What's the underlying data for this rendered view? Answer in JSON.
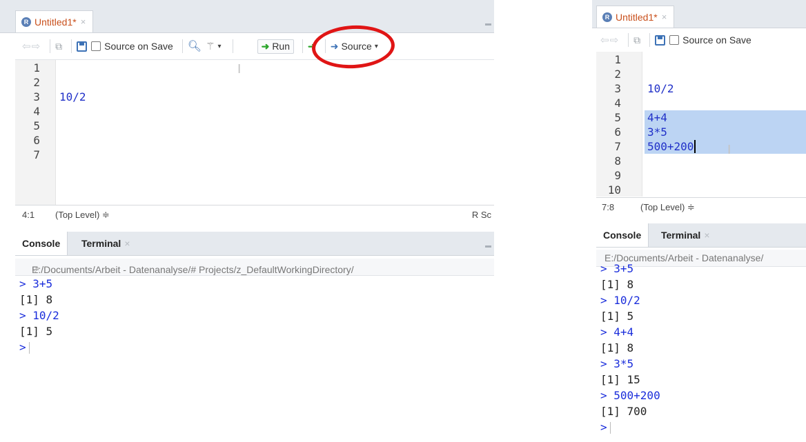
{
  "left": {
    "tab": {
      "title": "Untitled1*",
      "close": "×"
    },
    "toolbar": {
      "source_on_save": "Source on Save",
      "run": "Run",
      "source": "Source"
    },
    "editor": {
      "lines": [
        {
          "num": "1",
          "code": ""
        },
        {
          "num": "2",
          "code": ""
        },
        {
          "num": "3",
          "code": "10/2"
        },
        {
          "num": "4",
          "code": ""
        },
        {
          "num": "5",
          "code": ""
        },
        {
          "num": "6",
          "code": ""
        },
        {
          "num": "7",
          "code": ""
        }
      ]
    },
    "status": {
      "position": "4:1",
      "scope": "(Top Level) ≑",
      "lang": "R Sc"
    },
    "console_tabs": {
      "console": "Console",
      "terminal": "Terminal",
      "close": "×"
    },
    "path": "E:/Documents/Arbeit - Datenanalyse/# Projects/z_DefaultWorkingDirectory/",
    "console_lines": [
      {
        "text": "> 3+5",
        "kind": "cmd"
      },
      {
        "text": "[1] 8",
        "kind": "out"
      },
      {
        "text": "> 10/2",
        "kind": "cmd"
      },
      {
        "text": "[1] 5",
        "kind": "out"
      },
      {
        "text": ">",
        "kind": "prompt"
      }
    ]
  },
  "right": {
    "tab": {
      "title": "Untitled1*",
      "close": "×"
    },
    "toolbar": {
      "source_on_save": "Source on Save"
    },
    "editor": {
      "lines": [
        {
          "num": "1",
          "code": ""
        },
        {
          "num": "2",
          "code": ""
        },
        {
          "num": "3",
          "code": "10/2"
        },
        {
          "num": "4",
          "code": ""
        },
        {
          "num": "5",
          "code": "4+4"
        },
        {
          "num": "6",
          "code": "3*5"
        },
        {
          "num": "7",
          "code": "500+200"
        },
        {
          "num": "8",
          "code": ""
        },
        {
          "num": "9",
          "code": ""
        },
        {
          "num": "10",
          "code": ""
        }
      ]
    },
    "status": {
      "position": "7:8",
      "scope": "(Top Level) ≑"
    },
    "console_tabs": {
      "console": "Console",
      "terminal": "Terminal",
      "close": "×"
    },
    "path": "E:/Documents/Arbeit - Datenanalyse/",
    "console_lines": [
      {
        "text": "> 3+5",
        "kind": "cmd"
      },
      {
        "text": "[1] 8",
        "kind": "out"
      },
      {
        "text": "> 10/2",
        "kind": "cmd"
      },
      {
        "text": "[1] 5",
        "kind": "out"
      },
      {
        "text": "> 4+4",
        "kind": "cmd"
      },
      {
        "text": "[1] 8",
        "kind": "out"
      },
      {
        "text": "> 3*5",
        "kind": "cmd"
      },
      {
        "text": "[1] 15",
        "kind": "out"
      },
      {
        "text": "> 500+200",
        "kind": "cmd"
      },
      {
        "text": "[1] 700",
        "kind": "out"
      },
      {
        "text": ">",
        "kind": "prompt"
      }
    ]
  },
  "colors": {
    "annotation": "#e01515",
    "selection": "#bcd4f3",
    "code": "#2030c8"
  }
}
